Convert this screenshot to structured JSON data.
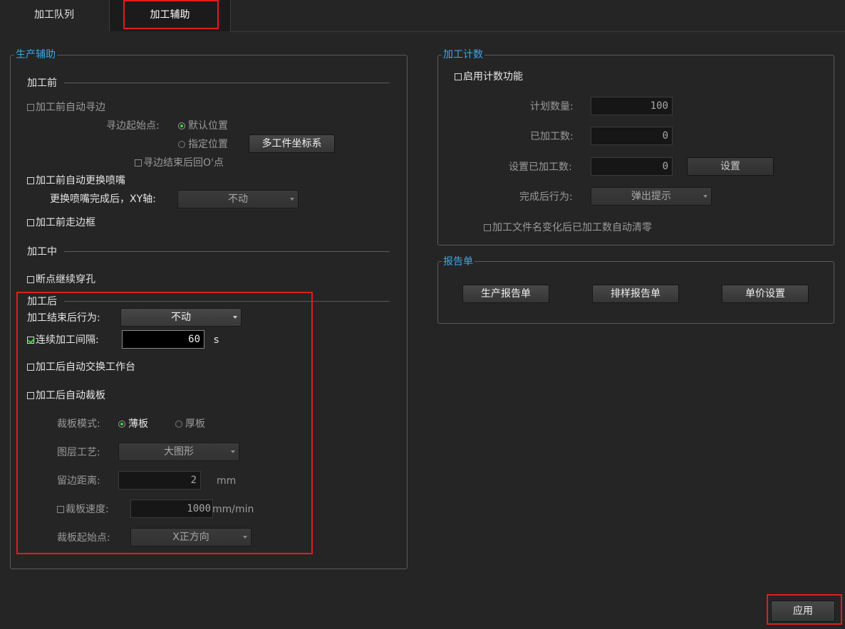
{
  "tabs": [
    "加工队列",
    "加工辅助"
  ],
  "production_assist": {
    "title": "生产辅助",
    "before": {
      "section": "加工前",
      "auto_edge_seek": "加工前自动寻边",
      "seek_start_label": "寻边起始点:",
      "radio_default": "默认位置",
      "radio_specified": "指定位置",
      "multi_workpiece_button": "多工件坐标系",
      "return_origin": "寻边结束后回O'点",
      "auto_nozzle_change": "加工前自动更换喷嘴",
      "after_nozzle_label": "更换喷嘴完成后，XY轴:",
      "after_nozzle_value": "不动",
      "frame_before": "加工前走边框"
    },
    "during": {
      "section": "加工中",
      "breakpoint_pierce": "断点继续穿孔"
    },
    "after": {
      "section": "加工后",
      "end_behavior_label": "加工结束后行为:",
      "end_behavior_value": "不动",
      "interval_label": "连续加工间隔:",
      "interval_value": "60",
      "interval_unit": "s",
      "auto_exchange": "加工后自动交换工作台",
      "auto_cut_board": "加工后自动裁板",
      "cut_mode_label": "裁板模式:",
      "mode_thin": "薄板",
      "mode_thick": "厚板",
      "layer_process_label": "图层工艺:",
      "layer_process_value": "大图形",
      "margin_label": "留边距离:",
      "margin_value": "2",
      "margin_unit": "mm",
      "cut_speed_label": "裁板速度:",
      "cut_speed_value": "1000",
      "cut_speed_unit": "mm/min",
      "cut_start_label": "裁板起始点:",
      "cut_start_value": "X正方向"
    }
  },
  "counter": {
    "title": "加工计数",
    "enable": "启用计数功能",
    "planned_label": "计划数量:",
    "planned_value": "100",
    "processed_label": "已加工数:",
    "processed_value": "0",
    "set_processed_label": "设置已加工数:",
    "set_processed_value": "0",
    "set_button": "设置",
    "after_done_label": "完成后行为:",
    "after_done_value": "弹出提示",
    "auto_clear": "加工文件名变化后已加工数自动清零"
  },
  "report": {
    "title": "报告单",
    "production_report": "生产报告单",
    "nesting_report": "排样报告单",
    "unit_price": "单价设置"
  },
  "apply_button": "应用",
  "colors": {
    "accent_title": "#3aa8e8",
    "highlight_red": "#e01e1e",
    "check_green": "#3cd23c",
    "background": "#252526"
  }
}
